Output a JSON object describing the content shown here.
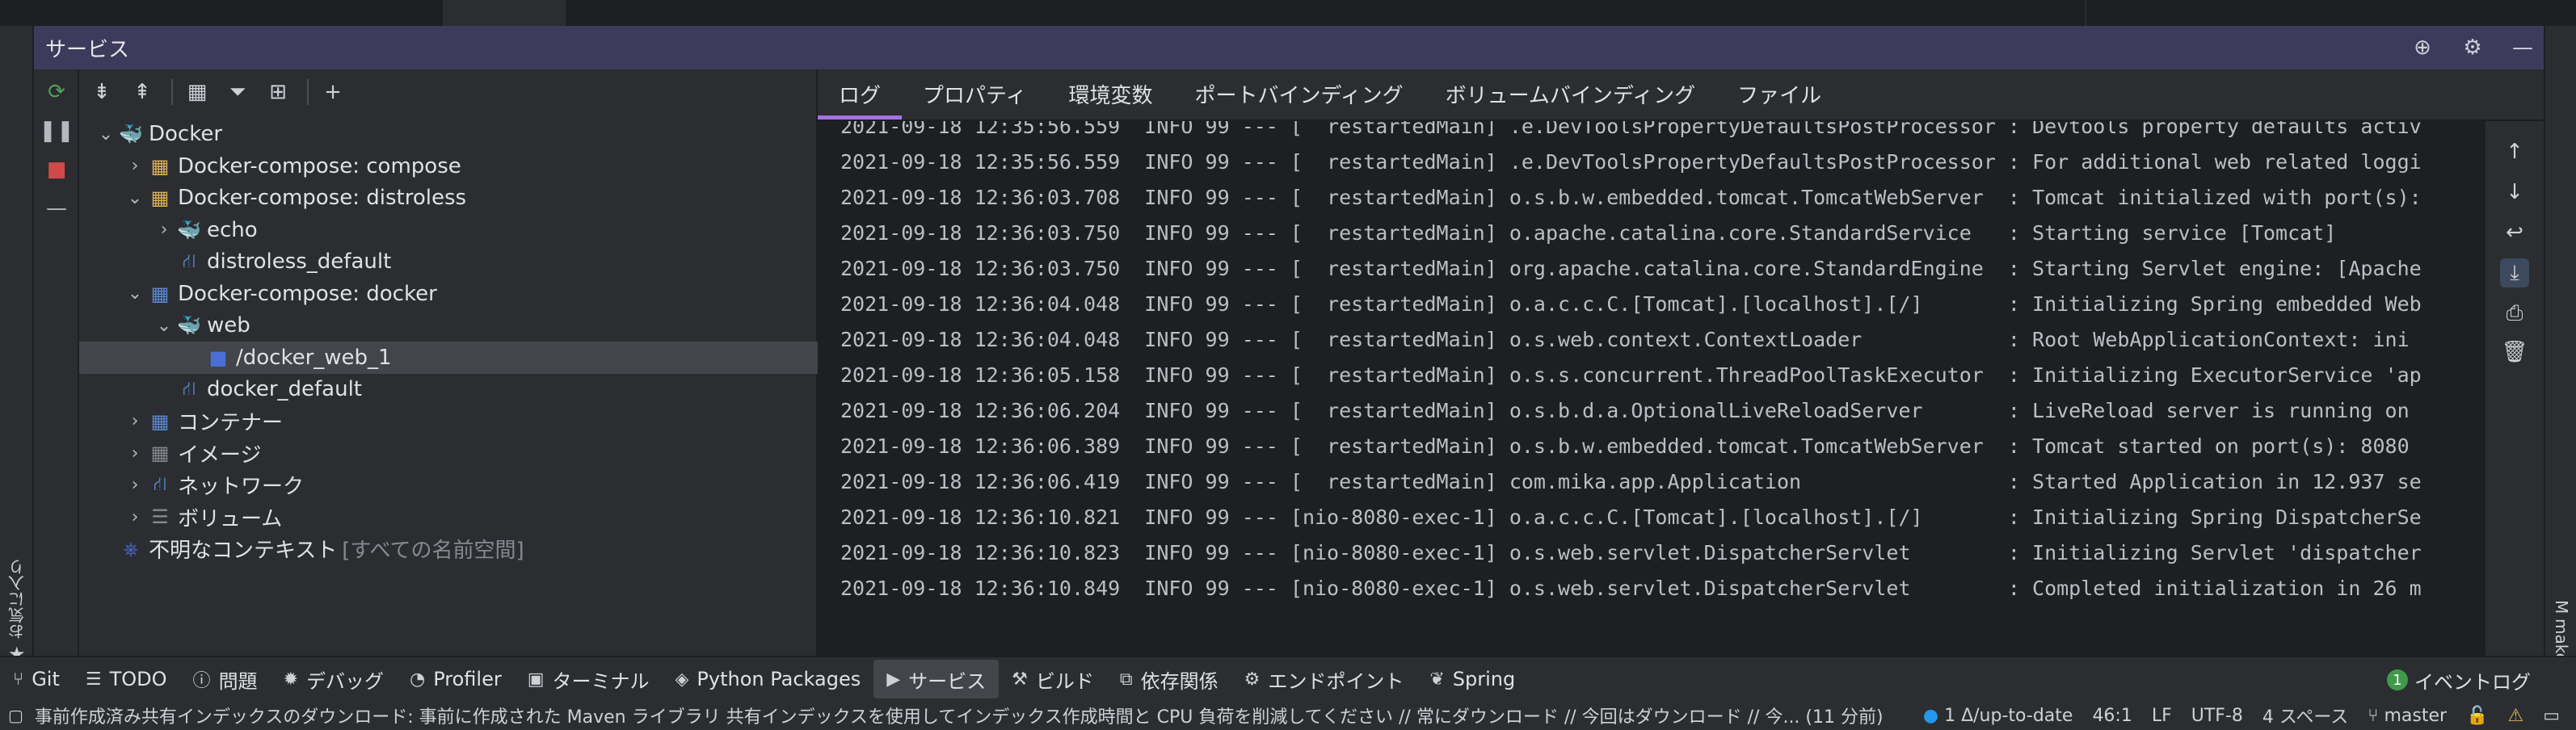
{
  "services": {
    "title": "サービス"
  },
  "favorites_label": "お気に入り",
  "make_label": "make",
  "tree": [
    {
      "label": "Docker",
      "depth": 0,
      "chevron": "down",
      "icon": "docker-icon",
      "glyph": "🐳",
      "color": "#2496ed"
    },
    {
      "label": "Docker-compose: compose",
      "depth": 1,
      "chevron": "right",
      "icon": "compose-icon",
      "glyph": "▦",
      "color": "#e0b35b"
    },
    {
      "label": "Docker-compose: distroless",
      "depth": 1,
      "chevron": "down",
      "icon": "compose-icon",
      "glyph": "▦",
      "color": "#e0b35b"
    },
    {
      "label": "echo",
      "depth": 2,
      "chevron": "right",
      "icon": "docker-service-icon",
      "glyph": "🐳",
      "color": "#e0a040"
    },
    {
      "label": "distroless_default",
      "depth": 2,
      "chevron": "",
      "icon": "network-icon",
      "glyph": "⛙",
      "color": "#5a8bd6"
    },
    {
      "label": "Docker-compose: docker",
      "depth": 1,
      "chevron": "down",
      "icon": "compose-icon",
      "glyph": "▦",
      "color": "#5a8bd6"
    },
    {
      "label": "web",
      "depth": 2,
      "chevron": "down",
      "icon": "docker-service-icon",
      "glyph": "🐳",
      "color": "#2496ed"
    },
    {
      "label": "/docker_web_1",
      "depth": 3,
      "chevron": "",
      "icon": "container-icon",
      "glyph": "■",
      "color": "#4b6fd6",
      "selected": true
    },
    {
      "label": "docker_default",
      "depth": 2,
      "chevron": "",
      "icon": "network-icon",
      "glyph": "⛙",
      "color": "#5a8bd6"
    },
    {
      "label": "コンテナー",
      "depth": 1,
      "chevron": "right",
      "icon": "containers-icon",
      "glyph": "▦",
      "color": "#5a8bd6"
    },
    {
      "label": "イメージ",
      "depth": 1,
      "chevron": "right",
      "icon": "images-icon",
      "glyph": "▦",
      "color": "#868a91"
    },
    {
      "label": "ネットワーク",
      "depth": 1,
      "chevron": "right",
      "icon": "networks-icon",
      "glyph": "⛙",
      "color": "#5a8bd6"
    },
    {
      "label": "ボリューム",
      "depth": 1,
      "chevron": "right",
      "icon": "volumes-icon",
      "glyph": "☰",
      "color": "#868a91"
    },
    {
      "label": "不明なコンテキスト",
      "depth": 0,
      "chevron": "",
      "icon": "unknown-context-icon",
      "glyph": "⎈",
      "color": "#4b6fd6",
      "suffix": "[すべての名前空間]"
    }
  ],
  "tabs": [
    "ログ",
    "プロパティ",
    "環境変数",
    "ポートバインディング",
    "ボリュームバインディング",
    "ファイル"
  ],
  "log_lines": [
    "2021-09-18 12:35:56.559  INFO 99 --- [  restartedMain] .e.DevToolsPropertyDefaultsPostProcessor : Devtools property defaults activ",
    "2021-09-18 12:35:56.559  INFO 99 --- [  restartedMain] .e.DevToolsPropertyDefaultsPostProcessor : For additional web related loggi",
    "2021-09-18 12:36:03.708  INFO 99 --- [  restartedMain] o.s.b.w.embedded.tomcat.TomcatWebServer  : Tomcat initialized with port(s):",
    "2021-09-18 12:36:03.750  INFO 99 --- [  restartedMain] o.apache.catalina.core.StandardService   : Starting service [Tomcat]",
    "2021-09-18 12:36:03.750  INFO 99 --- [  restartedMain] org.apache.catalina.core.StandardEngine  : Starting Servlet engine: [Apache",
    "2021-09-18 12:36:04.048  INFO 99 --- [  restartedMain] o.a.c.c.C.[Tomcat].[localhost].[/]       : Initializing Spring embedded Web",
    "2021-09-18 12:36:04.048  INFO 99 --- [  restartedMain] o.s.web.context.ContextLoader            : Root WebApplicationContext: ini",
    "2021-09-18 12:36:05.158  INFO 99 --- [  restartedMain] o.s.s.concurrent.ThreadPoolTaskExecutor  : Initializing ExecutorService 'ap",
    "2021-09-18 12:36:06.204  INFO 99 --- [  restartedMain] o.s.b.d.a.OptionalLiveReloadServer       : LiveReload server is running on",
    "2021-09-18 12:36:06.389  INFO 99 --- [  restartedMain] o.s.b.w.embedded.tomcat.TomcatWebServer  : Tomcat started on port(s): 8080",
    "2021-09-18 12:36:06.419  INFO 99 --- [  restartedMain] com.mika.app.Application                 : Started Application in 12.937 se",
    "2021-09-18 12:36:10.821  INFO 99 --- [nio-8080-exec-1] o.a.c.c.C.[Tomcat].[localhost].[/]       : Initializing Spring DispatcherSe",
    "2021-09-18 12:36:10.823  INFO 99 --- [nio-8080-exec-1] o.s.web.servlet.DispatcherServlet        : Initializing Servlet 'dispatcher",
    "2021-09-18 12:36:10.849  INFO 99 --- [nio-8080-exec-1] o.s.web.servlet.DispatcherServlet        : Completed initialization in 26 m"
  ],
  "bottom_tools": [
    {
      "label": "Git",
      "icon": "git-icon",
      "glyph": "⑂"
    },
    {
      "label": "TODO",
      "icon": "todo-icon",
      "glyph": "☰"
    },
    {
      "label": "問題",
      "icon": "problems-icon",
      "glyph": "ⓘ"
    },
    {
      "label": "デバッグ",
      "icon": "debug-icon",
      "glyph": "✹"
    },
    {
      "label": "Profiler",
      "icon": "profiler-icon",
      "glyph": "◔"
    },
    {
      "label": "ターミナル",
      "icon": "terminal-icon",
      "glyph": "▣"
    },
    {
      "label": "Python Packages",
      "icon": "python-packages-icon",
      "glyph": "◈"
    },
    {
      "label": "サービス",
      "icon": "services-icon",
      "glyph": "▶",
      "active": true
    },
    {
      "label": "ビルド",
      "icon": "build-icon",
      "glyph": "⚒"
    },
    {
      "label": "依存関係",
      "icon": "dependencies-icon",
      "glyph": "⧉"
    },
    {
      "label": "エンドポイント",
      "icon": "endpoints-icon",
      "glyph": "⚙"
    },
    {
      "label": "Spring",
      "icon": "spring-icon",
      "glyph": "❦"
    }
  ],
  "event_log": {
    "label": "イベントログ",
    "count": "1"
  },
  "status": {
    "message": "事前作成済み共有インデックスのダウンロード: 事前に作成された Maven ライブラリ 共有インデックスを使用してインデックス作成時間と CPU 負荷を削減してください // 常にダウンロード // 今回はダウンロード // 今... (11 分前)",
    "vcs": "1 Δ/up-to-date",
    "position": "46:1",
    "line_sep": "LF",
    "encoding": "UTF-8",
    "indent": "4 スペース",
    "branch": "master"
  },
  "colors": {
    "header": "#3d3a5c",
    "accent": "#a571e6",
    "run_green": "#4fa35c",
    "stop_red": "#d04a4a"
  }
}
